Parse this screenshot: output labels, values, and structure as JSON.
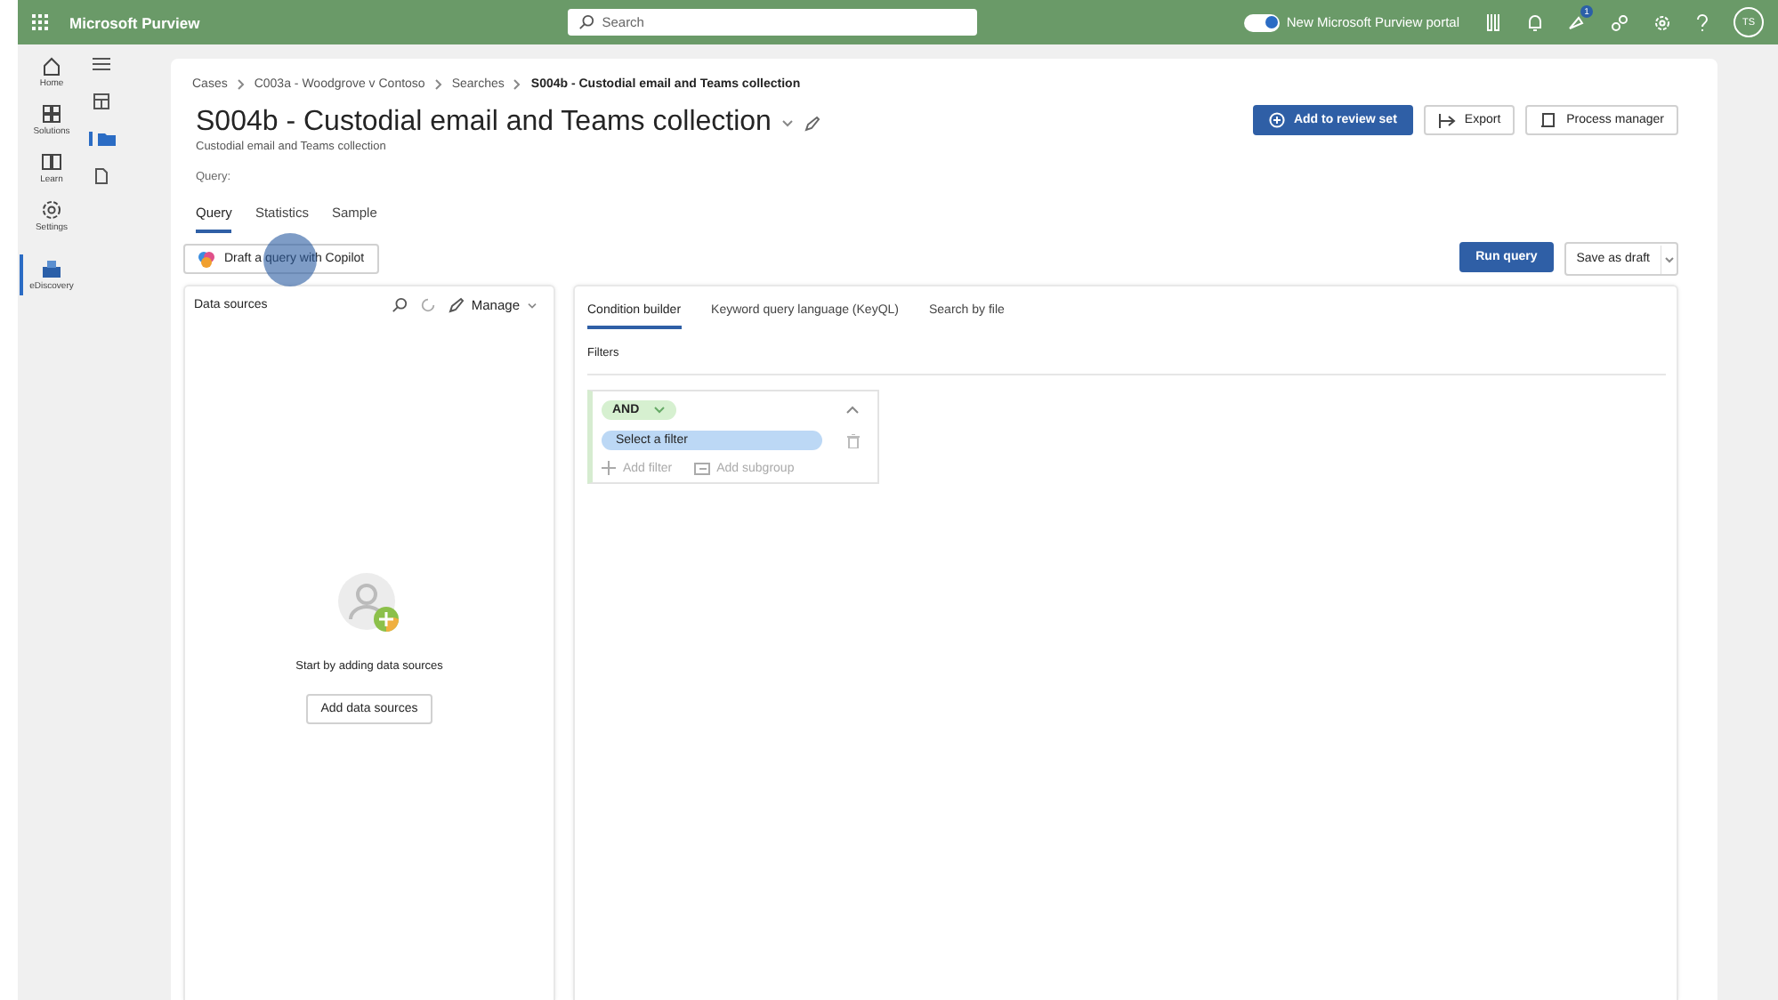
{
  "top_bar": {
    "app_title": "Microsoft Purview",
    "search_placeholder": "Search",
    "portal_toggle": {
      "label": "New Microsoft Purview portal",
      "on": true
    },
    "notification_badge": "1",
    "avatar": "TS"
  },
  "left_nav": [
    {
      "label": "Home",
      "selected": false
    },
    {
      "label": "Solutions",
      "selected": false
    },
    {
      "label": "Learn",
      "selected": false
    },
    {
      "label": "Settings",
      "selected": false
    },
    {
      "label": "eDiscovery",
      "selected": true
    }
  ],
  "breadcrumb": [
    "Cases",
    "C003a - Woodgrove v Contoso",
    "Searches",
    "S004b - Custodial email and Teams collection"
  ],
  "title": "S004b - Custodial email and Teams collection",
  "subtitle": "Custodial email and Teams collection",
  "query_label": "Query:",
  "actions": [
    {
      "label": "Add to review set",
      "kind": "primary"
    },
    {
      "label": "Export",
      "kind": "export"
    },
    {
      "label": "Process manager",
      "kind": "process"
    }
  ],
  "tabs": [
    {
      "label": "Query",
      "selected": true
    },
    {
      "label": "Statistics",
      "selected": false
    },
    {
      "label": "Sample",
      "selected": false
    }
  ],
  "copilot_button": "Draft a query with Copilot",
  "run_query": "Run query",
  "save_as_draft": "Save as draft",
  "data_sources": {
    "title": "Data sources",
    "manage": "Manage",
    "empty_text": "Start by adding data sources",
    "add_button": "Add data sources"
  },
  "query_tabs": [
    {
      "label": "Condition builder",
      "selected": true
    },
    {
      "label": "Keyword query language (KeyQL)",
      "selected": false
    },
    {
      "label": "Search by file",
      "selected": false
    }
  ],
  "filters_label": "Filters",
  "filter_group": {
    "operator": "AND",
    "expanded": true,
    "filter_placeholder": "Select a filter",
    "add_filter": "Add filter",
    "add_subgroup": "Add subgroup"
  }
}
